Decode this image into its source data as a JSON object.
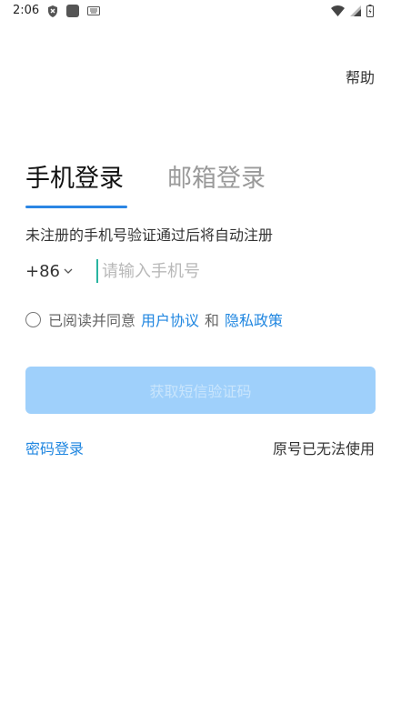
{
  "status_bar": {
    "time": "2:06"
  },
  "header": {
    "help_label": "帮助"
  },
  "tabs": [
    {
      "label": "手机登录",
      "active": true
    },
    {
      "label": "邮箱登录",
      "active": false
    }
  ],
  "hint": "未注册的手机号验证通过后将自动注册",
  "phone": {
    "country_code": "+86",
    "placeholder": "请输入手机号",
    "value": ""
  },
  "agreement": {
    "checked": false,
    "prefix": "已阅读并同意",
    "user_agreement": "用户协议",
    "conjunction": "和",
    "privacy_policy": "隐私政策"
  },
  "sms_button_label": "获取短信验证码",
  "footer": {
    "password_login": "密码登录",
    "lost_number": "原号已无法使用"
  },
  "colors": {
    "accent": "#1f86e0",
    "button_disabled": "#9fd0fb"
  }
}
